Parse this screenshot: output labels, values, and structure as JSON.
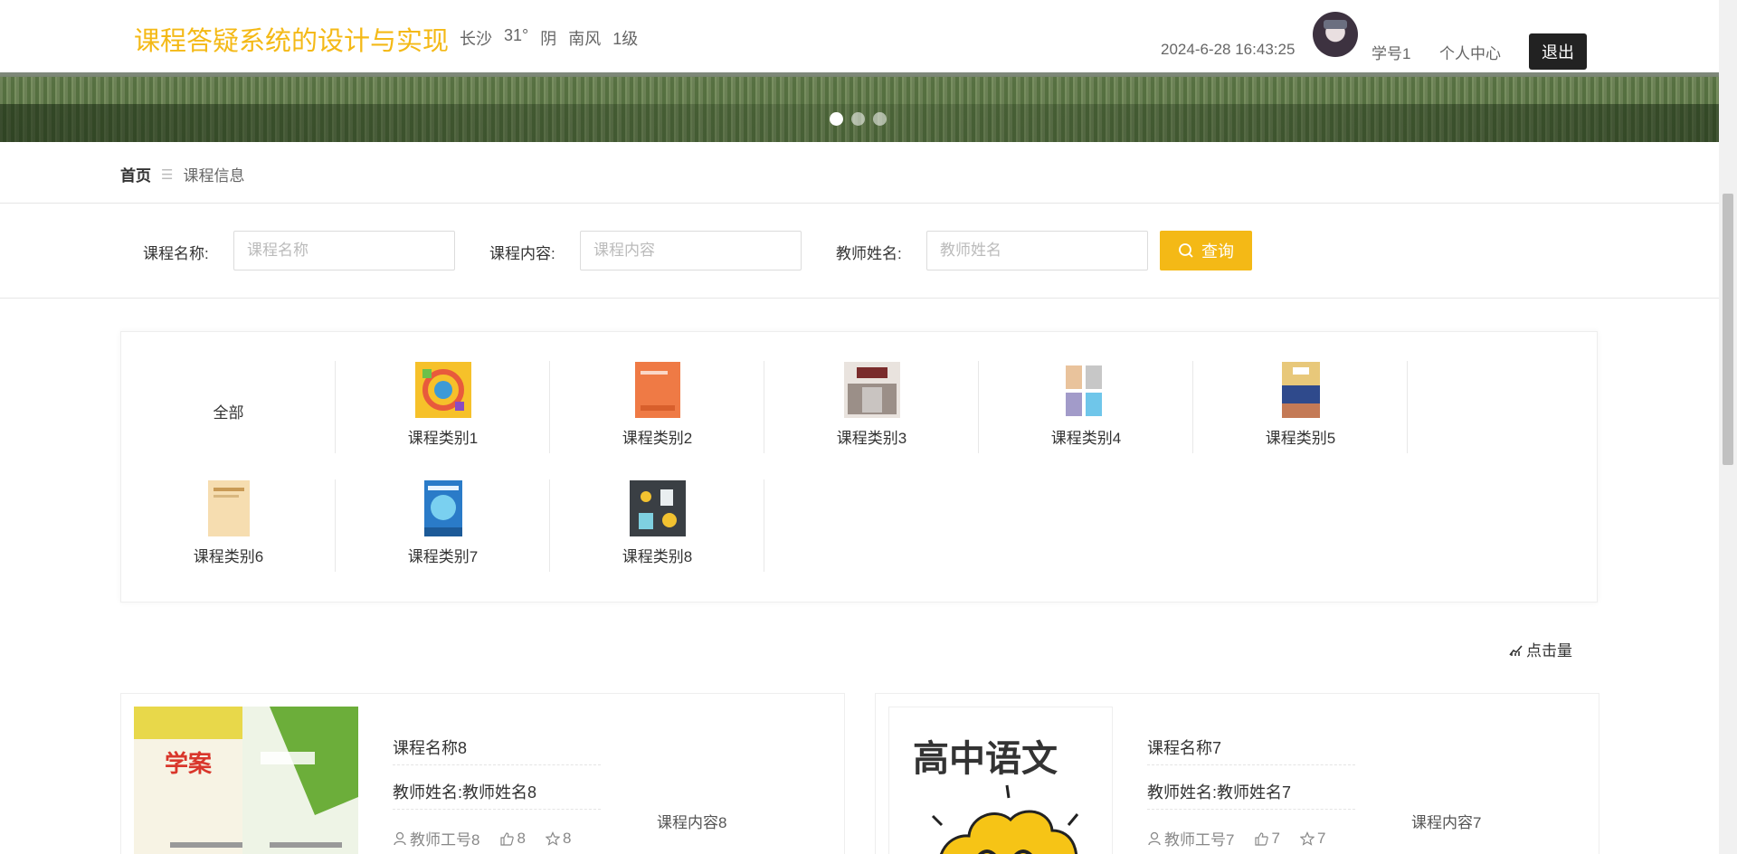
{
  "header": {
    "site_title": "课程答疑系统的设计与实现",
    "weather": {
      "city": "长沙",
      "temp": "31°",
      "condition": "阴",
      "wind": "南风",
      "level": "1级"
    },
    "datetime": "2024-6-28 16:43:25",
    "student_id": "学号1",
    "profile_label": "个人中心",
    "logout_label": "退出"
  },
  "breadcrumb": {
    "home": "首页",
    "separator": "☰",
    "current": "课程信息"
  },
  "search": {
    "course_name_label": "课程名称:",
    "course_name_placeholder": "课程名称",
    "course_content_label": "课程内容:",
    "course_content_placeholder": "课程内容",
    "teacher_name_label": "教师姓名:",
    "teacher_name_placeholder": "教师姓名",
    "query_label": "查询"
  },
  "categories": {
    "all_label": "全部",
    "items": [
      "课程类别1",
      "课程类别2",
      "课程类别3",
      "课程类别4",
      "课程类别5",
      "课程类别6",
      "课程类别7",
      "课程类别8"
    ]
  },
  "sort": {
    "label": "点击量"
  },
  "courses": [
    {
      "name": "课程名称8",
      "teacher": "教师姓名:教师姓名8",
      "teacher_no": "教师工号8",
      "likes": "8",
      "favorites": "8",
      "content": "课程内容8"
    },
    {
      "name": "课程名称7",
      "teacher": "教师姓名:教师姓名7",
      "teacher_no": "教师工号7",
      "likes": "7",
      "favorites": "7",
      "content": "课程内容7",
      "cover_text": "高中语文"
    }
  ],
  "colors": {
    "accent": "#f4b916",
    "logout_bg": "#222222"
  }
}
